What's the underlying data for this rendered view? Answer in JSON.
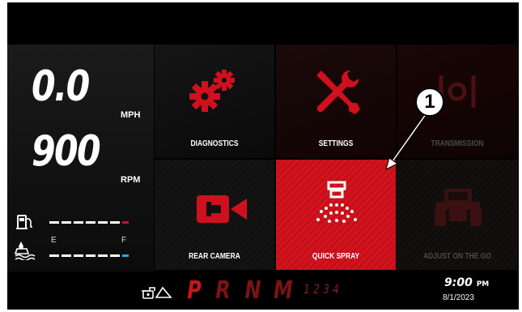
{
  "gauges": {
    "speed_value": "0.0",
    "speed_unit": "MPH",
    "rpm_value": "900",
    "rpm_unit": "RPM",
    "fuel_icon": "fuel-pump-icon",
    "fluid_icon": "spray-tank-level-icon",
    "tank_empty_label": "E",
    "tank_full_label": "F"
  },
  "tiles": {
    "diagnostics": {
      "label": "DIAGNOSTICS",
      "icon": "gears-icon"
    },
    "settings": {
      "label": "SETTINGS",
      "icon": "tools-icon"
    },
    "transmission": {
      "label": "TRANSMISSION",
      "icon": "transmission-icon"
    },
    "rear_camera": {
      "label": "REAR CAMERA",
      "icon": "camera-icon"
    },
    "quick_spray": {
      "label": "QUICK SPRAY",
      "icon": "spray-nozzle-icon"
    },
    "adjust_on_the_go": {
      "label": "ADJUST ON THE GO",
      "icon": "tractor-icon"
    }
  },
  "status": {
    "park_brake_icon": "parking-brake-icon",
    "gears": [
      "P",
      "R",
      "N",
      "M"
    ],
    "gear_numbers": [
      "1",
      "2",
      "3",
      "4"
    ],
    "time": "9:00",
    "ampm": "PM",
    "date": "8/1/2023"
  },
  "callout": {
    "label": "1"
  },
  "colors": {
    "accent_red": "#c8102e",
    "tile_dark": "#1a1a1a",
    "blue_level": "#2aa9e6"
  }
}
